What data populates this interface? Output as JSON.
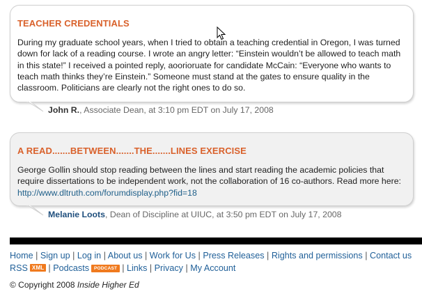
{
  "comments": [
    {
      "title": "TEACHER CREDENTIALS",
      "body": "During my graduate school years, when I tried to obtain a teaching credential in Oregon, I was turned down for lack of a reading course. I wrote an angry letter: “Einstein wouldn’t be allowed to teach math in this state!” I received a pointed reply, aoorioruate for candidate McCain: “Everyone who wants to teach math thinks they’re Einstein.” Someone must stand at the gates to ensure quality in the classroom. Politicians are clearly not the right ones to do so.",
      "author": "John R.",
      "author_meta": ", Associate Dean, at 3:10 pm EDT on July 17, 2008"
    },
    {
      "title": "A READ.......BETWEEN.......THE.......LINES EXERCISE",
      "body": "George Gollin should stop reading between the lines and start reading the academic policies that require dissertations to be independent work, not the collaboration of 16 co-authors. Read more here: ",
      "link_text": "http://www.dltruth.com/forumdisplay.php?fid=18",
      "author": "Melanie Loots",
      "author_meta": ", Dean of Discipline at UIUC, at 3:50 pm EDT on July 17, 2008"
    }
  ],
  "footer": {
    "links": [
      "Home",
      "Sign up",
      "Log in",
      "About us",
      "Work for Us",
      "Press Releases",
      "Rights and permissions",
      "Contact us"
    ],
    "rss_label": "RSS",
    "xml_badge": "XML",
    "podcasts_label": "Podcasts",
    "podcast_badge": "PODCAST",
    "links2": [
      "Links",
      "Privacy",
      "My Account"
    ],
    "separator": "|",
    "copyright_prefix": "© Copyright 2008",
    "copyright_brand": "Inside Higher Ed"
  },
  "colors": {
    "title_accent": "#d9612b",
    "link": "#1f5f98",
    "badge": "#f07a1e"
  },
  "icons": [
    "mouse-pointer-icon",
    "xml-feed-icon",
    "podcast-icon"
  ]
}
